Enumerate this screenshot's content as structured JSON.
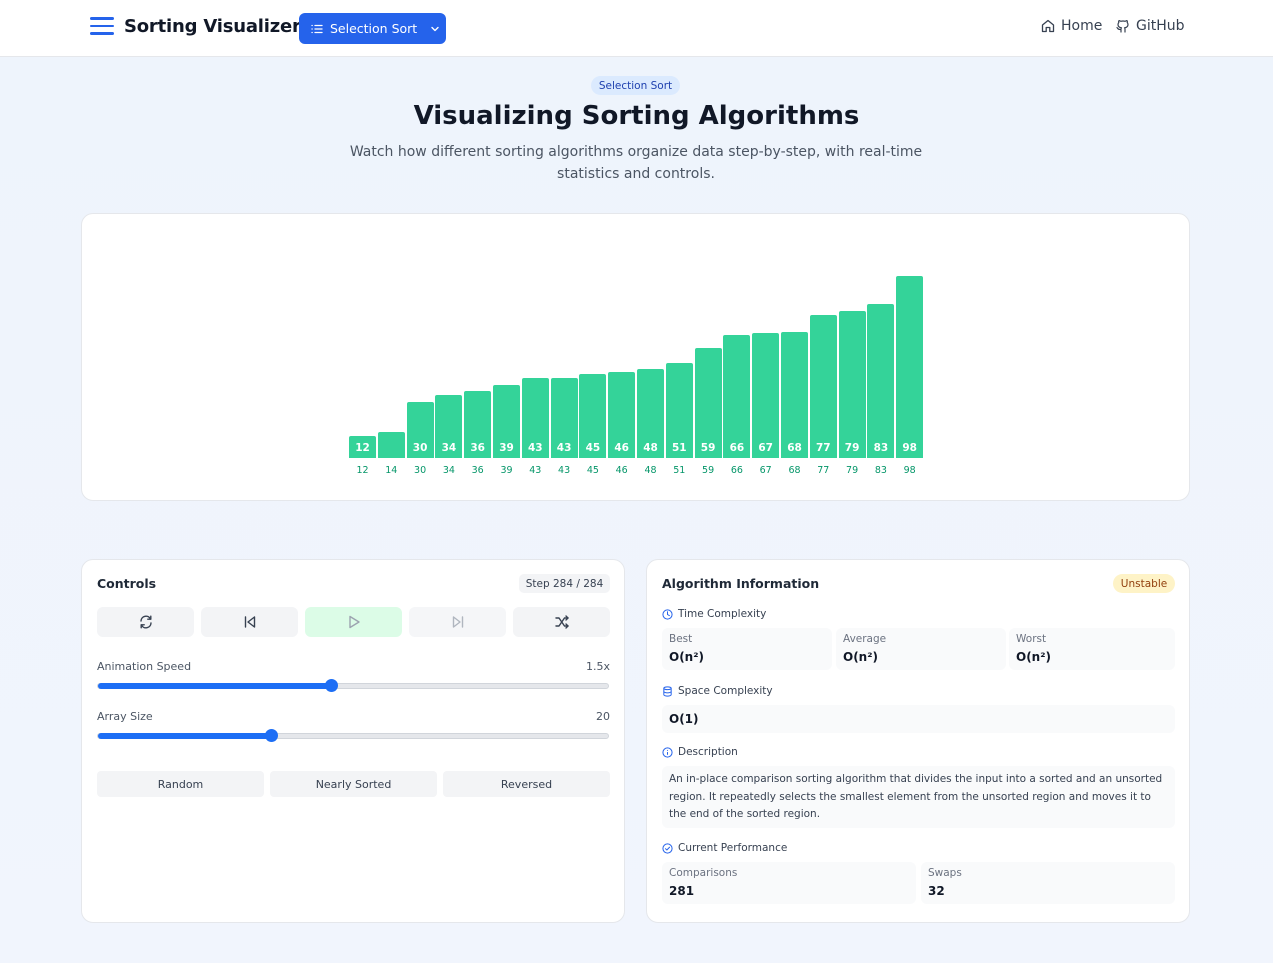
{
  "header": {
    "brand": "Sorting Visualizer",
    "algorithm_button": "Selection Sort",
    "nav_home": "Home",
    "nav_github": "GitHub",
    "accent": "#2563eb"
  },
  "hero": {
    "badge": "Selection Sort",
    "title": "Visualizing Sorting Algorithms",
    "subtitle": "Watch how different sorting algorithms organize data step-by-step, with real-time statistics and controls."
  },
  "chart_data": {
    "type": "bar",
    "categories": [
      "12",
      "14",
      "30",
      "34",
      "36",
      "39",
      "43",
      "43",
      "45",
      "46",
      "48",
      "51",
      "59",
      "66",
      "67",
      "68",
      "77",
      "79",
      "83",
      "98"
    ],
    "values": [
      12,
      14,
      30,
      34,
      36,
      39,
      43,
      43,
      45,
      46,
      48,
      51,
      59,
      66,
      67,
      68,
      77,
      79,
      83,
      98
    ],
    "bar_labels": [
      "12",
      "",
      "30",
      "34",
      "36",
      "39",
      "43",
      "43",
      "45",
      "46",
      "48",
      "51",
      "59",
      "66",
      "67",
      "68",
      "77",
      "79",
      "83",
      "98"
    ],
    "bar_color": "#34d399",
    "label_color": "#059669"
  },
  "controls": {
    "title": "Controls",
    "step": "Step 284 / 284",
    "buttons": [
      "reset-icon",
      "step-back-icon",
      "play-icon",
      "step-forward-icon",
      "shuffle-icon"
    ],
    "speed": {
      "label": "Animation Speed",
      "value_text": "1.5x",
      "fraction": 0.457
    },
    "size": {
      "label": "Array Size",
      "value_text": "20",
      "fraction": 0.339
    },
    "presets": [
      "Random",
      "Nearly Sorted",
      "Reversed"
    ]
  },
  "info": {
    "title": "Algorithm Information",
    "stability": "Unstable",
    "time_heading": "Time Complexity",
    "best_label": "Best",
    "best_value": "O(n²)",
    "avg_label": "Average",
    "avg_value": "O(n²)",
    "worst_label": "Worst",
    "worst_value": "O(n²)",
    "space_heading": "Space Complexity",
    "space_value": "O(1)",
    "desc_heading": "Description",
    "description": "An in-place comparison sorting algorithm that divides the input into a sorted and an unsorted region. It repeatedly selects the smallest element from the unsorted region and moves it to the end of the sorted region.",
    "perf_heading": "Current Performance",
    "comparisons_label": "Comparisons",
    "comparisons_value": "281",
    "swaps_label": "Swaps",
    "swaps_value": "32"
  }
}
